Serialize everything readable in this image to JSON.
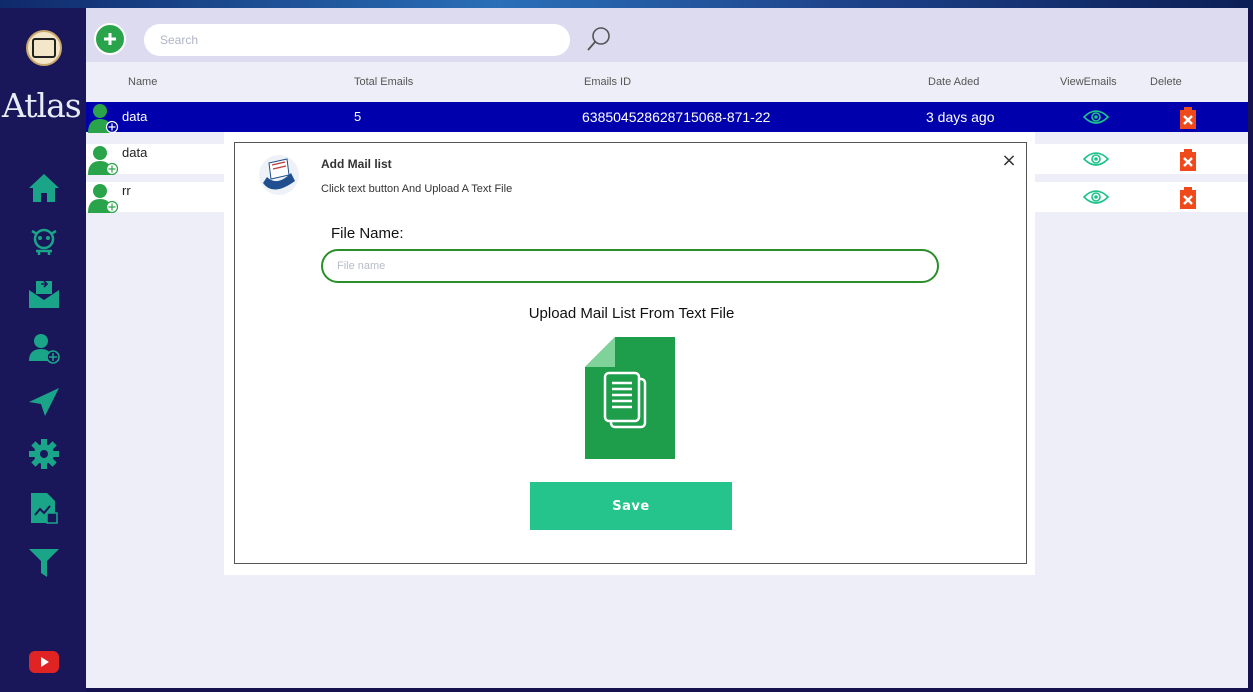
{
  "app": {
    "title": "Atlas"
  },
  "search": {
    "placeholder": "Search"
  },
  "table": {
    "headers": {
      "name": "Name",
      "total": "Total Emails",
      "id": "Emails ID",
      "date": "Date Aded",
      "view": "ViewEmails",
      "delete": "Delete"
    },
    "rows": [
      {
        "name": "data",
        "total": "5",
        "id": "638504528628715068-871-22",
        "date": "3 days ago",
        "selected": true
      },
      {
        "name": "data",
        "total": "",
        "id": "",
        "date": "",
        "selected": false
      },
      {
        "name": "rr",
        "total": "",
        "id": "",
        "date": "",
        "selected": false
      }
    ]
  },
  "modal": {
    "title": "Add Mail list",
    "description": "Click text button And Upload A Text File",
    "close": "×",
    "file_name_label": "File Name:",
    "file_name_placeholder": "File name",
    "upload_label": "Upload Mail List From Text File",
    "save_label": "Save"
  },
  "colors": {
    "accent": "#25c48c",
    "selected_row": "#0000ad",
    "sidebar": "#1a165a",
    "icon_teal": "#1aa589"
  }
}
